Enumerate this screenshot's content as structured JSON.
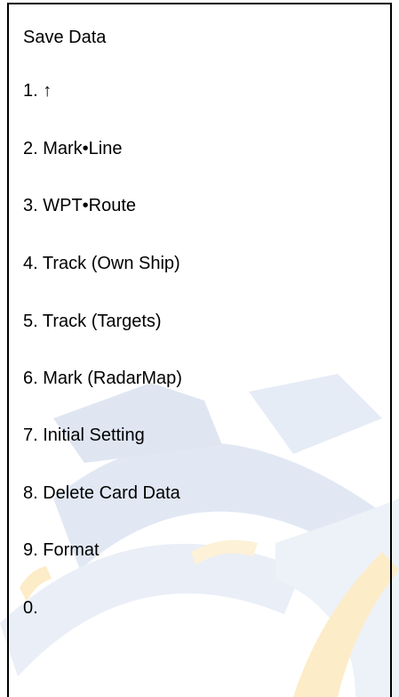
{
  "menu": {
    "title": "Save Data",
    "items": [
      {
        "label": "1. ↑"
      },
      {
        "label": "2. Mark•Line"
      },
      {
        "label": "3. WPT•Route"
      },
      {
        "label": "4. Track (Own Ship)"
      },
      {
        "label": "5. Track (Targets)"
      },
      {
        "label": "6. Mark (RadarMap)"
      },
      {
        "label": "7. Initial Setting"
      },
      {
        "label": "8. Delete Card Data"
      },
      {
        "label": "9. Format"
      },
      {
        "label": "0."
      }
    ]
  },
  "colors": {
    "text": "#000000",
    "border": "#000000",
    "watermark_blue": "#e1e8f4",
    "watermark_light_blue": "#edf1f8",
    "watermark_orange": "#fcecc8"
  }
}
